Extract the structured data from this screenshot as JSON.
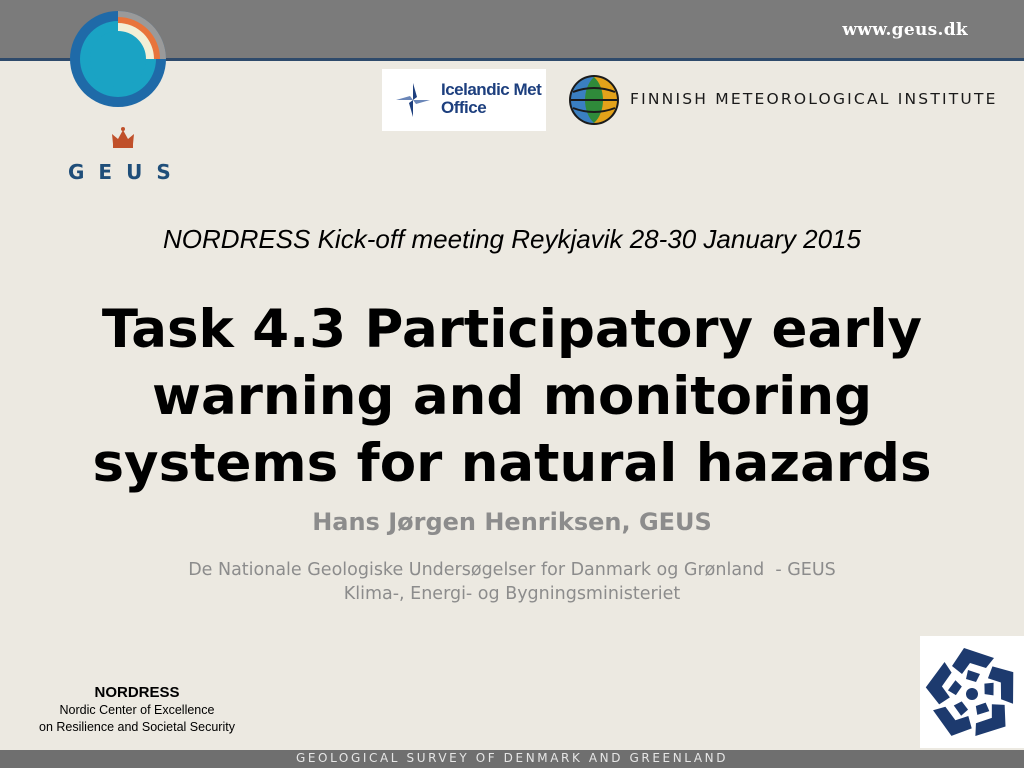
{
  "header": {
    "url": "www.geus.dk",
    "geus_wordmark": "GEUS"
  },
  "partners": {
    "imo_name": "Icelandic Met\nOffice",
    "fmi_name": "FINNISH METEOROLOGICAL INSTITUTE"
  },
  "slide": {
    "meeting": "NORDRESS Kick-off meeting Reykjavik 28-30 January 2015",
    "title": "Task 4.3 Participatory early warning and monitoring systems for natural hazards",
    "author": "Hans Jørgen Henriksen, GEUS",
    "affiliation_1": "De Nationale Geologiske Undersøgelser for Danmark og Grønland  - GEUS",
    "affiliation_2": "Klima-, Energi- og Bygningsministeriet"
  },
  "nordress": {
    "title": "NORDRESS",
    "line_1": "Nordic Center of Excellence",
    "line_2": "on Resilience and Societal Security"
  },
  "footer": {
    "text": "GEOLOGICAL SURVEY OF DENMARK AND GREENLAND"
  },
  "colors": {
    "top_bar": "#7b7b7b",
    "geus_blue": "#1f4e79",
    "geus_cyan": "#1aa3c4",
    "geus_orange": "#e8743b",
    "background": "#ece9e1",
    "grey_text": "#8c8c8c"
  }
}
